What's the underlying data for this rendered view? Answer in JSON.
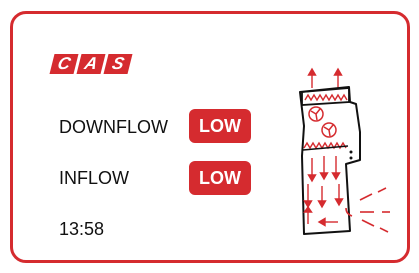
{
  "logo": {
    "letters": [
      "C",
      "A",
      "S"
    ],
    "color": "#d52b2f"
  },
  "status": {
    "downflow": {
      "label": "DOWNFLOW",
      "value": "LOW"
    },
    "inflow": {
      "label": "INFLOW",
      "value": "LOW"
    }
  },
  "clock": {
    "time": "13:58"
  },
  "colors": {
    "accent": "#d52b2f",
    "text": "#111111",
    "background": "#ffffff"
  },
  "illustration": {
    "icon": "biosafety-cabinet-airflow-icon"
  }
}
